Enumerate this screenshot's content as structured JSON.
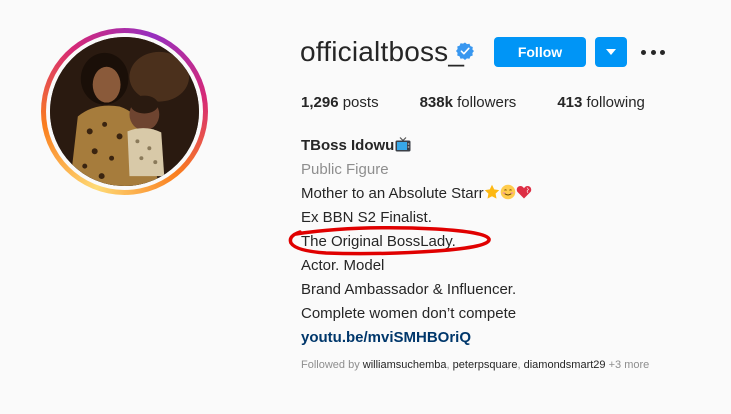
{
  "profile": {
    "username": "officialtboss_",
    "verified": true,
    "follow_label": "Follow",
    "accent_color": "#0095f6",
    "counts": {
      "posts_value": "1,296",
      "posts_label": " posts",
      "followers_value": "838k",
      "followers_label": " followers",
      "following_value": "413",
      "following_label": " following"
    },
    "bio": {
      "name": "TBoss Idowu",
      "category": "Public Figure",
      "lines": [
        "Mother to an Absolute Starr",
        "Ex BBN S2 Finalist.",
        "The Original BossLady.",
        "Actor. Model",
        "Brand Ambassador & Influencer.",
        "Complete women don’t compete"
      ],
      "link": "youtu.be/mviSMHBOriQ"
    },
    "followed_by": {
      "prefix": "Followed by ",
      "user1": "williamsuchemba",
      "sep1": ", ",
      "user2": "peterpsquare",
      "sep2": ", ",
      "user3": "diamondsmart29",
      "more": " +3 more"
    }
  },
  "icons": {
    "verified": "verified-badge-icon",
    "dropdown": "chevron-down-icon",
    "more": "more-options-icon",
    "tv": "tv-emoji-icon",
    "emojis": [
      "star-emoji-icon",
      "smiling-face-emoji-icon",
      "heart-emoji-icon"
    ]
  },
  "annotation": {
    "color": "#e00000"
  }
}
